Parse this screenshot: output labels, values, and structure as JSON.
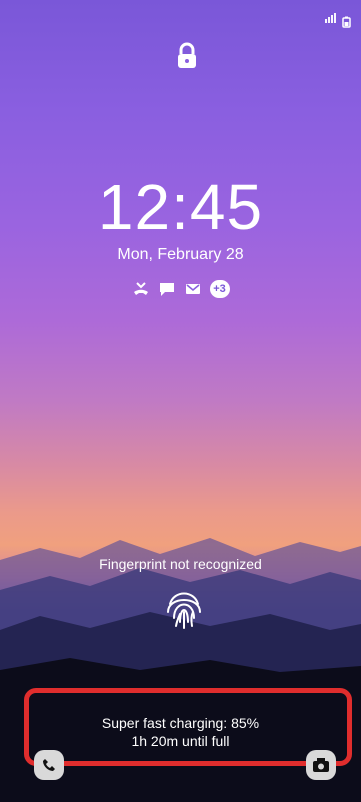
{
  "status": {
    "icons": [
      "signal-icon",
      "battery-icon"
    ]
  },
  "lock": {
    "icon": "lock-icon"
  },
  "clock": {
    "time": "12:45",
    "date": "Mon, February 28"
  },
  "notifications": {
    "icons": [
      "missed-call-icon",
      "message-icon",
      "mail-icon"
    ],
    "more_count": "+3"
  },
  "fingerprint": {
    "text": "Fingerprint not recognized",
    "icon": "fingerprint-icon"
  },
  "charging": {
    "line1": "Super fast charging: 85%",
    "line2": "1h 20m until full"
  },
  "shortcuts": {
    "left": "phone-icon",
    "right": "camera-icon"
  },
  "colors": {
    "highlight": "#e02d2d"
  }
}
